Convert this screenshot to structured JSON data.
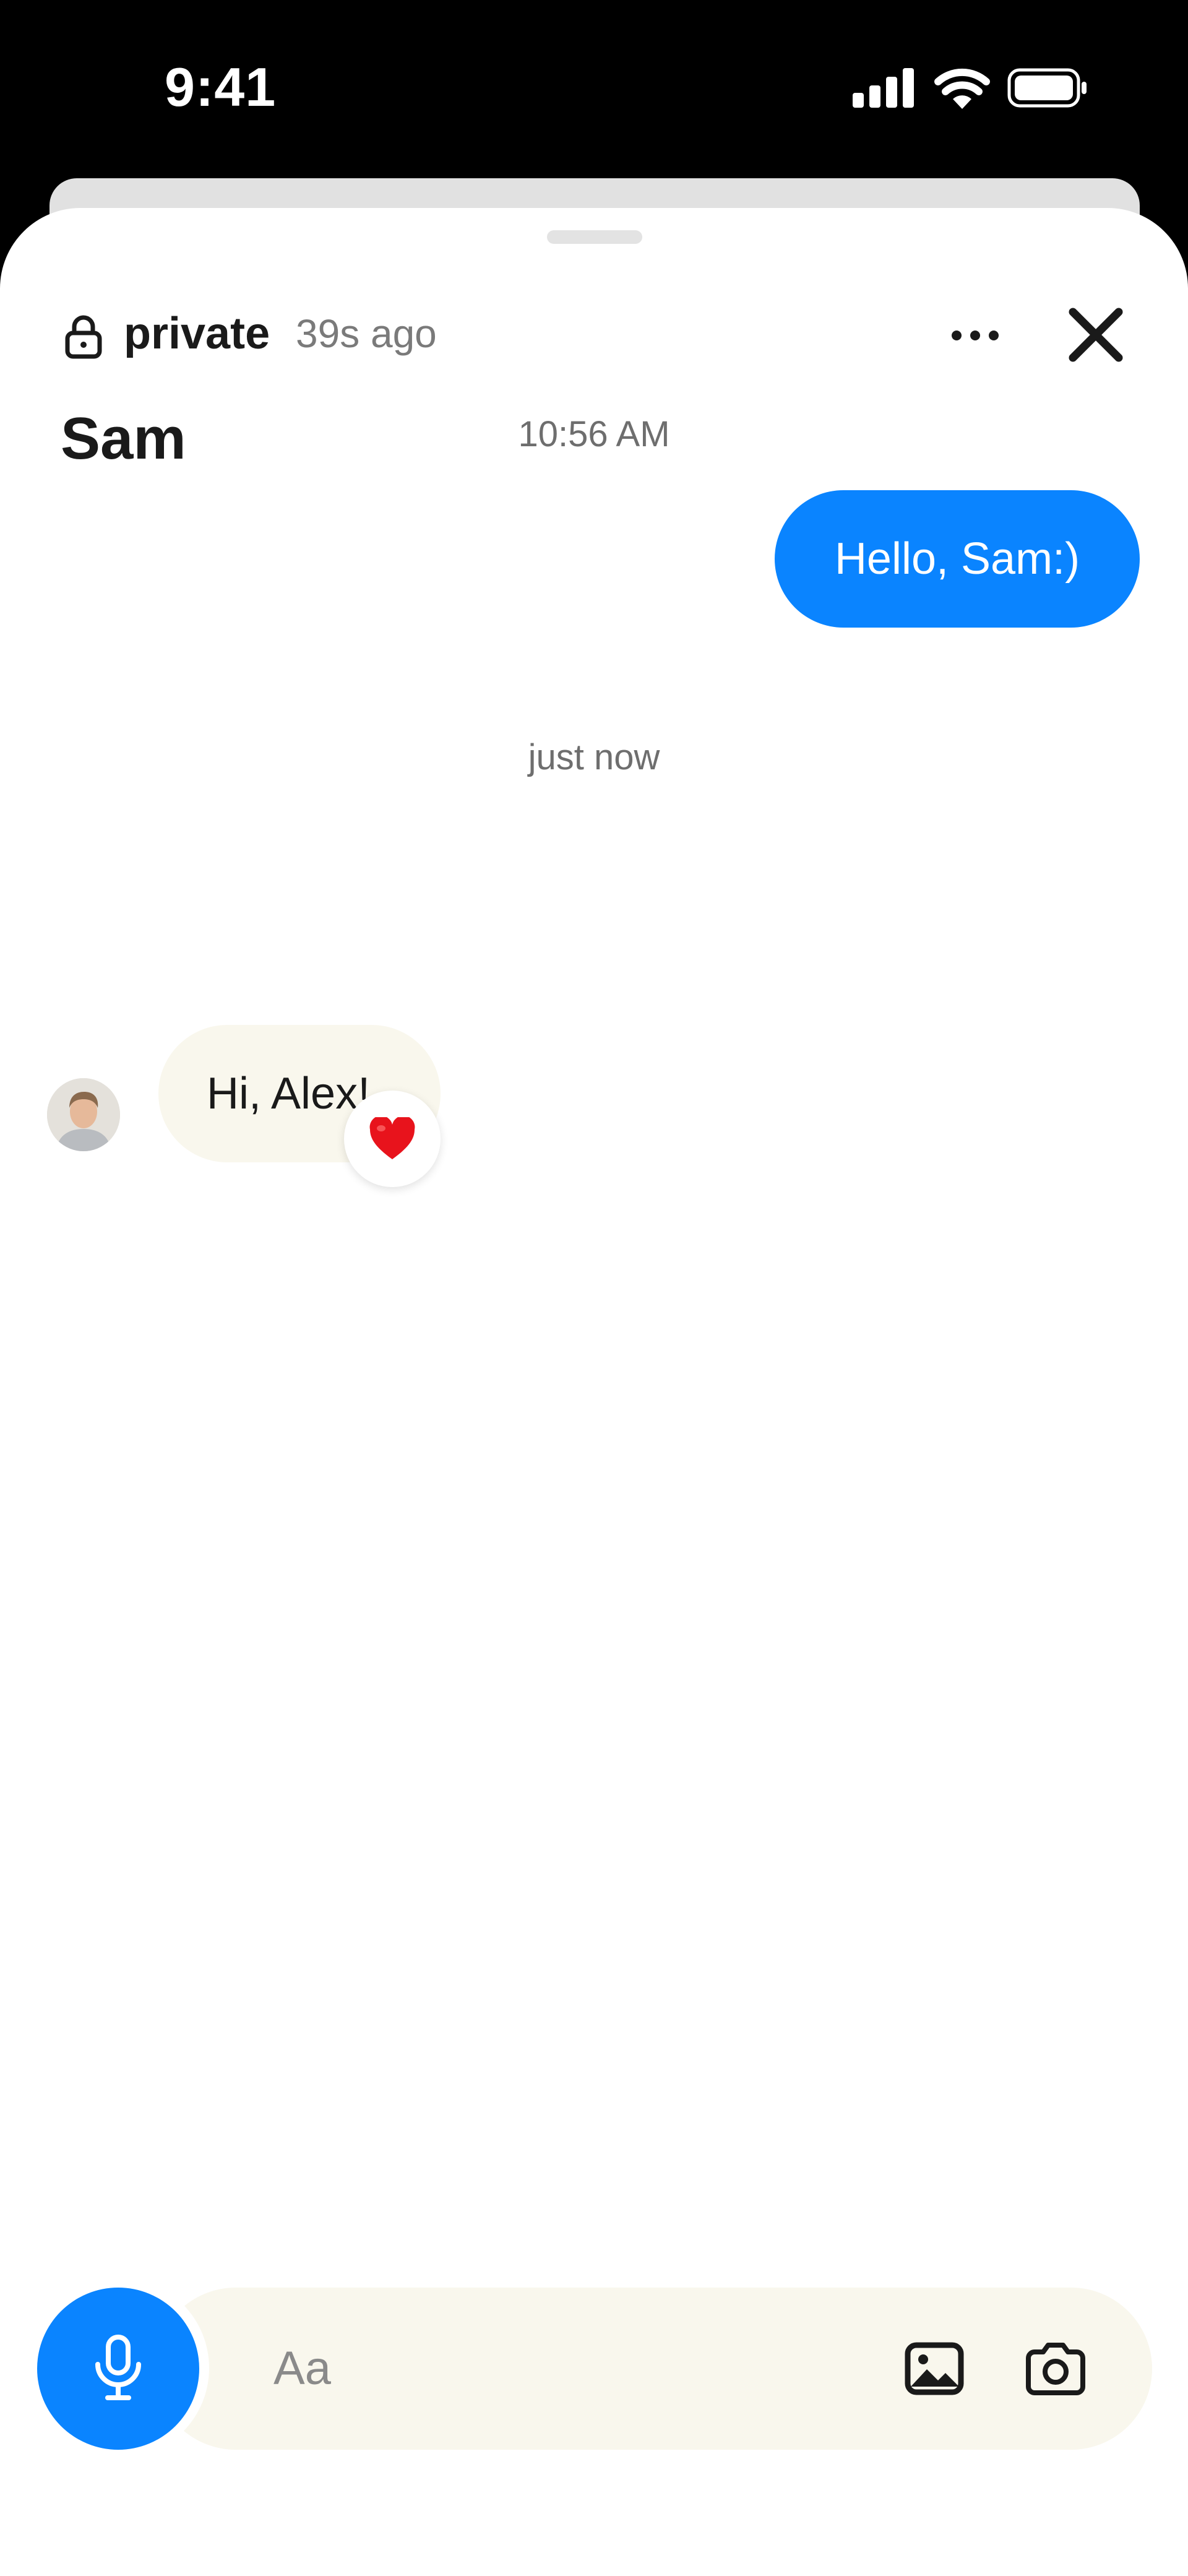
{
  "status_bar": {
    "time": "9:41",
    "icons": [
      "cellular-signal-icon",
      "wifi-icon",
      "battery-icon"
    ]
  },
  "header": {
    "privacy_label": "private",
    "last_seen": "39s ago",
    "contact_name": "Sam",
    "icons": [
      "lock-icon",
      "more-icon",
      "close-icon"
    ]
  },
  "messages": [
    {
      "timestamp": "10:56 AM",
      "direction": "outgoing",
      "text": "Hello, Sam:)"
    },
    {
      "timestamp": "just now",
      "direction": "incoming",
      "text": "Hi, Alex!",
      "reaction": "❤️"
    }
  ],
  "composer": {
    "placeholder": "Aa",
    "icons": [
      "microphone-icon",
      "gallery-icon",
      "camera-icon"
    ]
  },
  "colors": {
    "accent": "#0a84ff",
    "incoming_bubble": "#f9f7ed",
    "text": "#1a1a1a",
    "muted": "#7a7a7a"
  }
}
